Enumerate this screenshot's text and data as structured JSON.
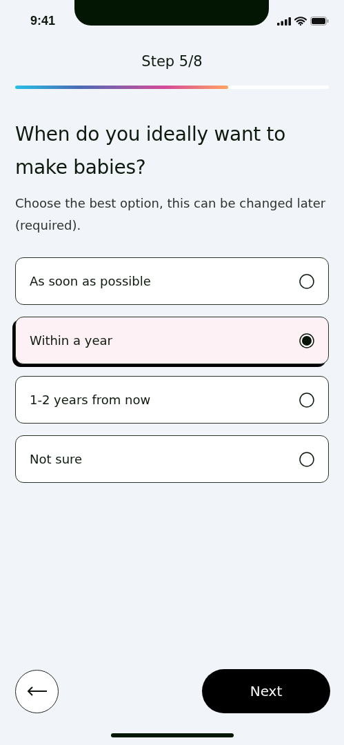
{
  "status_bar": {
    "time": "9:41"
  },
  "header": {
    "step": "Step 5/8",
    "progress": {
      "level": 0.68
    }
  },
  "question": {
    "title": "When do you ideally want to make babies?",
    "subtitle": "Choose the best option, this can be changed later (required)."
  },
  "options": [
    {
      "label": "As soon as possible",
      "selected": false
    },
    {
      "label": "Within a year",
      "selected": true
    },
    {
      "label": "1-2 years from now",
      "selected": false
    },
    {
      "label": "Not sure",
      "selected": false
    }
  ],
  "footer": {
    "next": "Next"
  }
}
